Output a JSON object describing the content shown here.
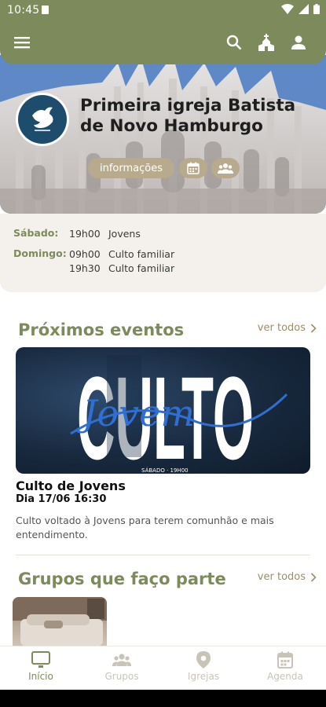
{
  "status": {
    "time": "10:45"
  },
  "church": {
    "name": "Primeira igreja Batista de Novo Hamburgo",
    "buttons": {
      "info": "informações"
    }
  },
  "schedule": [
    {
      "day": "Sábado:",
      "entries": [
        {
          "time": "19h00",
          "label": "Jovens"
        }
      ]
    },
    {
      "day": "Domingo:",
      "entries": [
        {
          "time": "09h00",
          "label": "Culto familiar"
        },
        {
          "time": "19h30",
          "label": "Culto familiar"
        }
      ]
    }
  ],
  "events": {
    "title": "Próximos eventos",
    "see_all": "ver todos",
    "banner": {
      "word": "CULTO",
      "script": "Jovem",
      "small": "SÁBADO · 19H00"
    },
    "item": {
      "title": "Culto de Jovens",
      "date": "Dia 17/06 16:30",
      "description": "Culto voltado à Jovens para terem comunhão e mais entendimento."
    }
  },
  "groups": {
    "title": "Grupos que faço parte",
    "see_all": "ver todos"
  },
  "nav": [
    {
      "label": "Início",
      "icon": "tv-icon",
      "active": true
    },
    {
      "label": "Grupos",
      "icon": "groups-icon",
      "active": false
    },
    {
      "label": "Igrejas",
      "icon": "location-pin-icon",
      "active": false
    },
    {
      "label": "Agenda",
      "icon": "calendar-icon",
      "active": false
    }
  ],
  "colors": {
    "primary": "#7c8a5c",
    "accent": "#b8aa8c",
    "link": "#9d8d6a",
    "inactive": "#c9c4b8"
  }
}
